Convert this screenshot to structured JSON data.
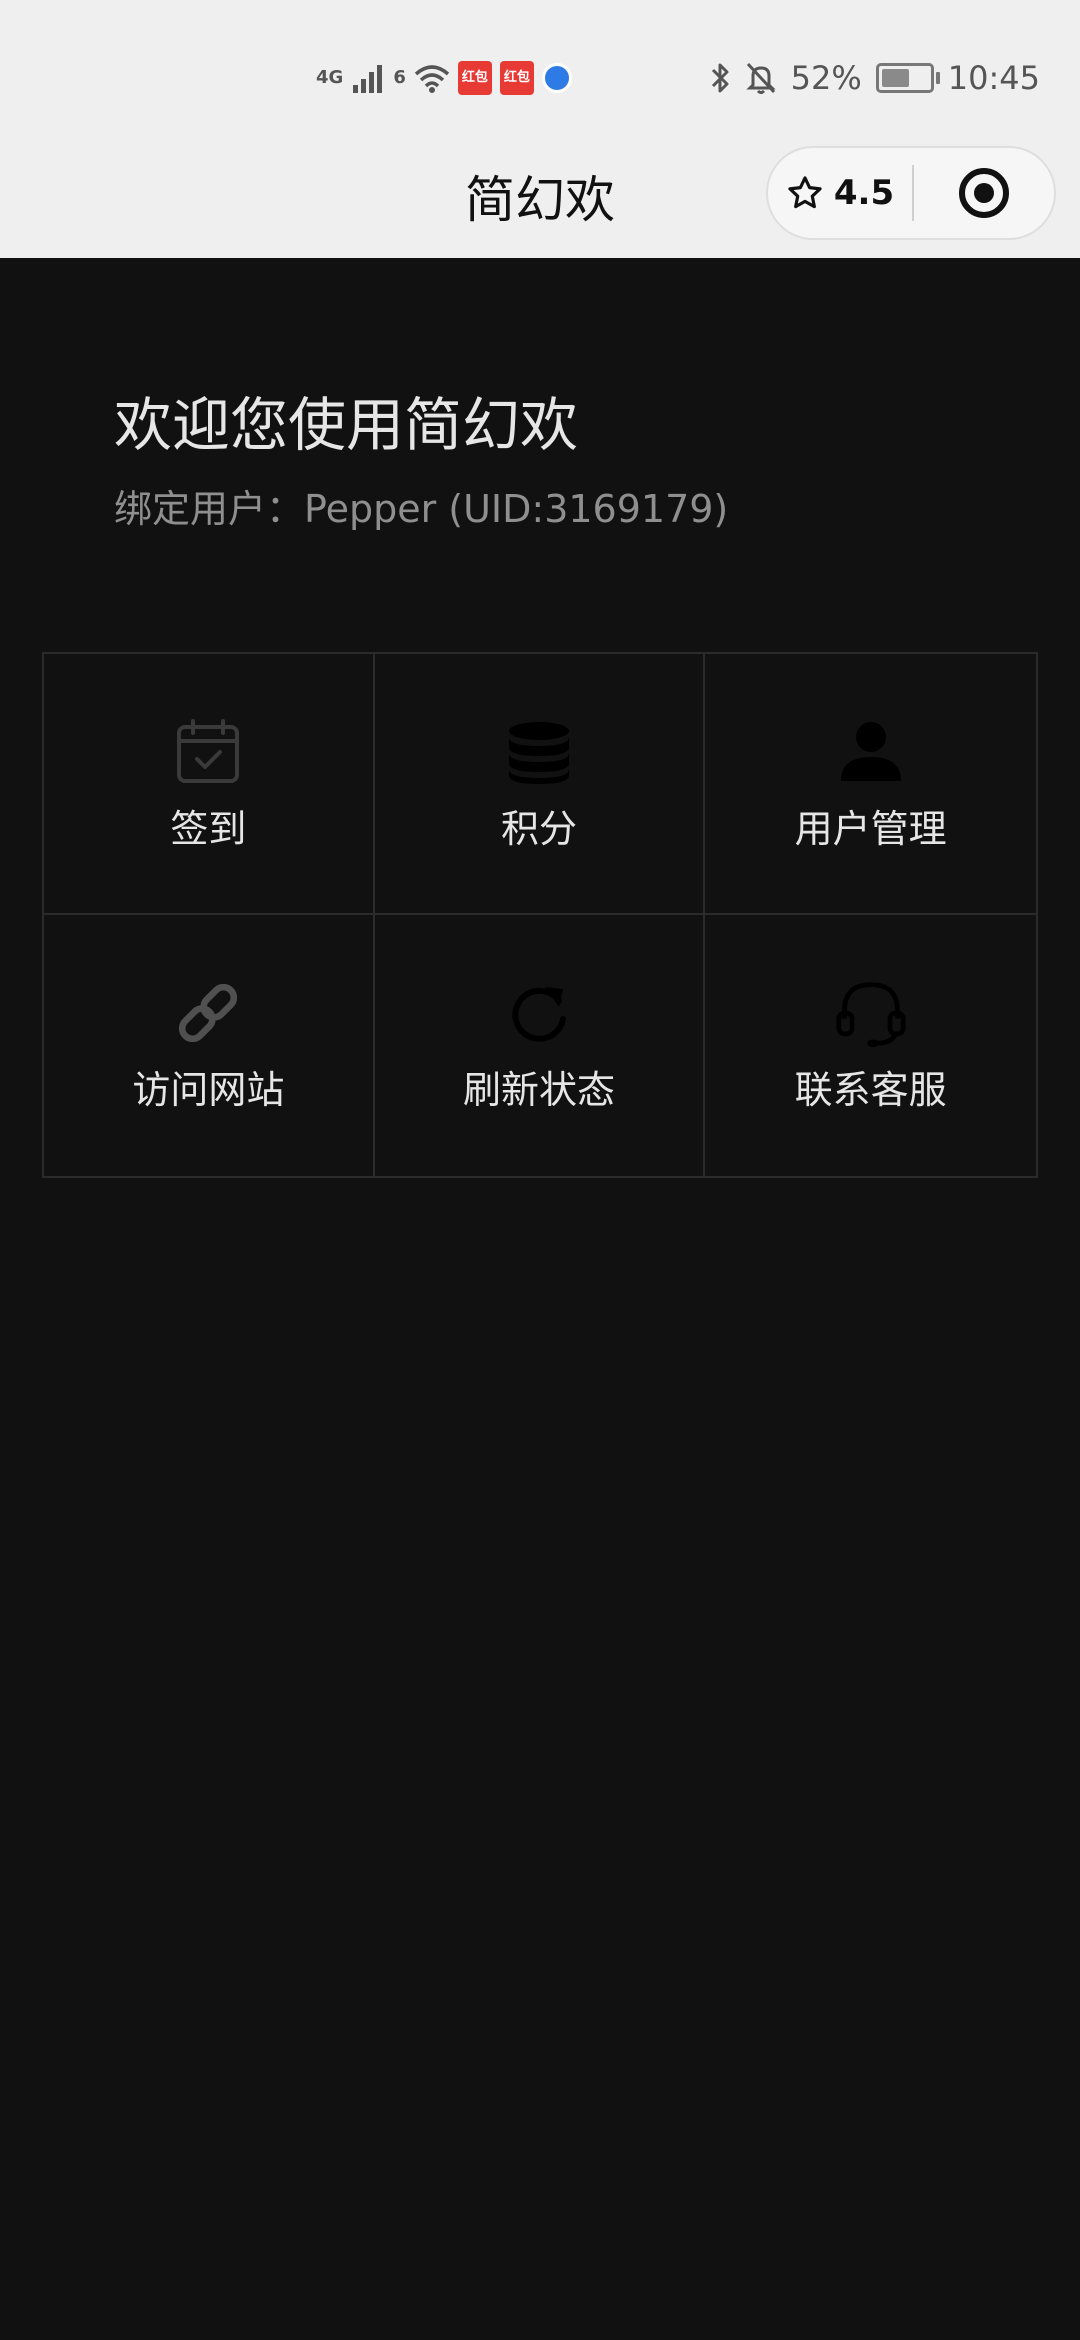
{
  "status_bar": {
    "network_label": "4G",
    "network_label_2": "6",
    "badge_text": "红包",
    "battery_percent": "52%",
    "battery_level": 0.52,
    "time": "10:45"
  },
  "nav": {
    "title": "简幻欢",
    "rating": "4.5"
  },
  "welcome": {
    "heading": "欢迎您使用简幻欢",
    "bound_label": "绑定用户：",
    "bound_user": "Pepper (UID:3169179)"
  },
  "menu": {
    "items": [
      {
        "label": "签到",
        "icon": "calendar-check-icon"
      },
      {
        "label": "积分",
        "icon": "coin-stack-icon"
      },
      {
        "label": "用户管理",
        "icon": "user-icon"
      },
      {
        "label": "访问网站",
        "icon": "link-icon"
      },
      {
        "label": "刷新状态",
        "icon": "refresh-icon"
      },
      {
        "label": "联系客服",
        "icon": "headset-icon"
      }
    ]
  },
  "colors": {
    "background": "#111111",
    "header": "#efefef",
    "text_primary": "#e6e6e6",
    "text_secondary": "#8f8f8f"
  }
}
